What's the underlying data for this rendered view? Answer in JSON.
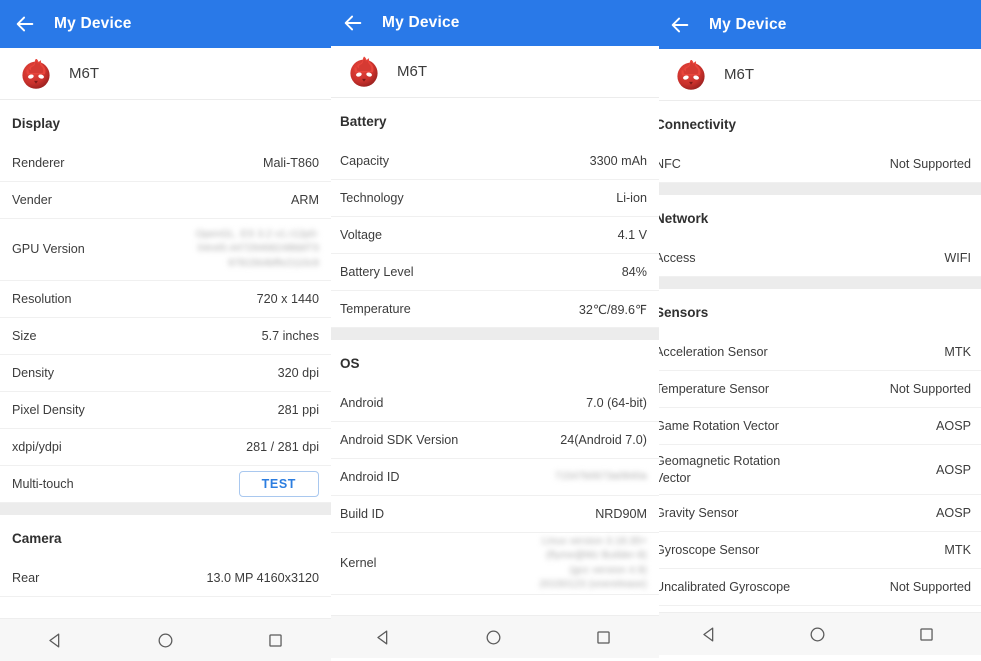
{
  "theme": {
    "appbar_color": "#2979e8",
    "accent_color": "#2b7de0",
    "text_color": "#3c3c3c",
    "divider_color": "#ececec"
  },
  "appbar": {
    "title": "My Device",
    "back_icon": "arrow-left-icon"
  },
  "device": {
    "name": "M6T",
    "logo_icon": "antutu-flame-logo"
  },
  "navbar": {
    "back_icon": "triangle-back-icon",
    "home_icon": "circle-home-icon",
    "recents_icon": "square-recents-icon"
  },
  "panels": [
    {
      "id": "panel-display-camera",
      "sections": [
        {
          "title": "Display",
          "rows": [
            {
              "label": "Renderer",
              "value": "Mali-T860"
            },
            {
              "label": "Vender",
              "value": "ARM"
            },
            {
              "label": "GPU Version",
              "value": "OpenGL. ES 3.2 v1.r12p0-\n04rel0.44729468248bbf73\n9781564bffe2110c9",
              "blurred": true,
              "tall": true
            },
            {
              "label": "Resolution",
              "value": "720 x 1440"
            },
            {
              "label": "Size",
              "value": "5.7 inches"
            },
            {
              "label": "Density",
              "value": "320 dpi"
            },
            {
              "label": "Pixel Density",
              "value": "281 ppi"
            },
            {
              "label": "xdpi/ydpi",
              "value": "281 / 281 dpi"
            },
            {
              "label": "Multi-touch",
              "value": "TEST",
              "button": true
            }
          ]
        },
        {
          "title": "Camera",
          "rows": [
            {
              "label": "Rear",
              "value": "13.0 MP 4160x3120"
            }
          ]
        }
      ]
    },
    {
      "id": "panel-battery-os",
      "sections": [
        {
          "title": "Battery",
          "rows": [
            {
              "label": "Capacity",
              "value": "3300 mAh"
            },
            {
              "label": "Technology",
              "value": "Li-ion"
            },
            {
              "label": "Voltage",
              "value": "4.1 V"
            },
            {
              "label": "Battery Level",
              "value": "84%"
            },
            {
              "label": "Temperature",
              "value": "32℃/89.6℉"
            }
          ]
        },
        {
          "title": "OS",
          "rows": [
            {
              "label": "Android",
              "value": "7.0 (64-bit)"
            },
            {
              "label": "Android SDK Version",
              "value": "24(Android 7.0)"
            },
            {
              "label": "Android ID",
              "value": "71547b0673a0840a",
              "blurred": true
            },
            {
              "label": "Build ID",
              "value": "NRD90M"
            },
            {
              "label": "Kernel",
              "value": "Linux version 3.18.35+\n(flyme@Mz Builder-8)\n(gcc version 4.9)\n20150123 (onerelease)",
              "blurred": true,
              "tall": true
            }
          ]
        }
      ]
    },
    {
      "id": "panel-connectivity-sensors",
      "sections": [
        {
          "title": "Connectivity",
          "rows": [
            {
              "label": "NFC",
              "value": "Not Supported"
            }
          ]
        },
        {
          "title": "Network",
          "rows": [
            {
              "label": "Access",
              "value": "WIFI"
            }
          ]
        },
        {
          "title": "Sensors",
          "rows": [
            {
              "label": "Acceleration Sensor",
              "value": "MTK"
            },
            {
              "label": "Temperature Sensor",
              "value": "Not Supported"
            },
            {
              "label": "Game Rotation Vector",
              "value": "AOSP"
            },
            {
              "label": "Geomagnetic Rotation\nVector",
              "value": "AOSP",
              "twoline": true
            },
            {
              "label": "Gravity Sensor",
              "value": "AOSP"
            },
            {
              "label": "Gyroscope Sensor",
              "value": "MTK"
            },
            {
              "label": "Uncalibrated Gyroscope",
              "value": "Not Supported"
            }
          ]
        }
      ]
    }
  ]
}
